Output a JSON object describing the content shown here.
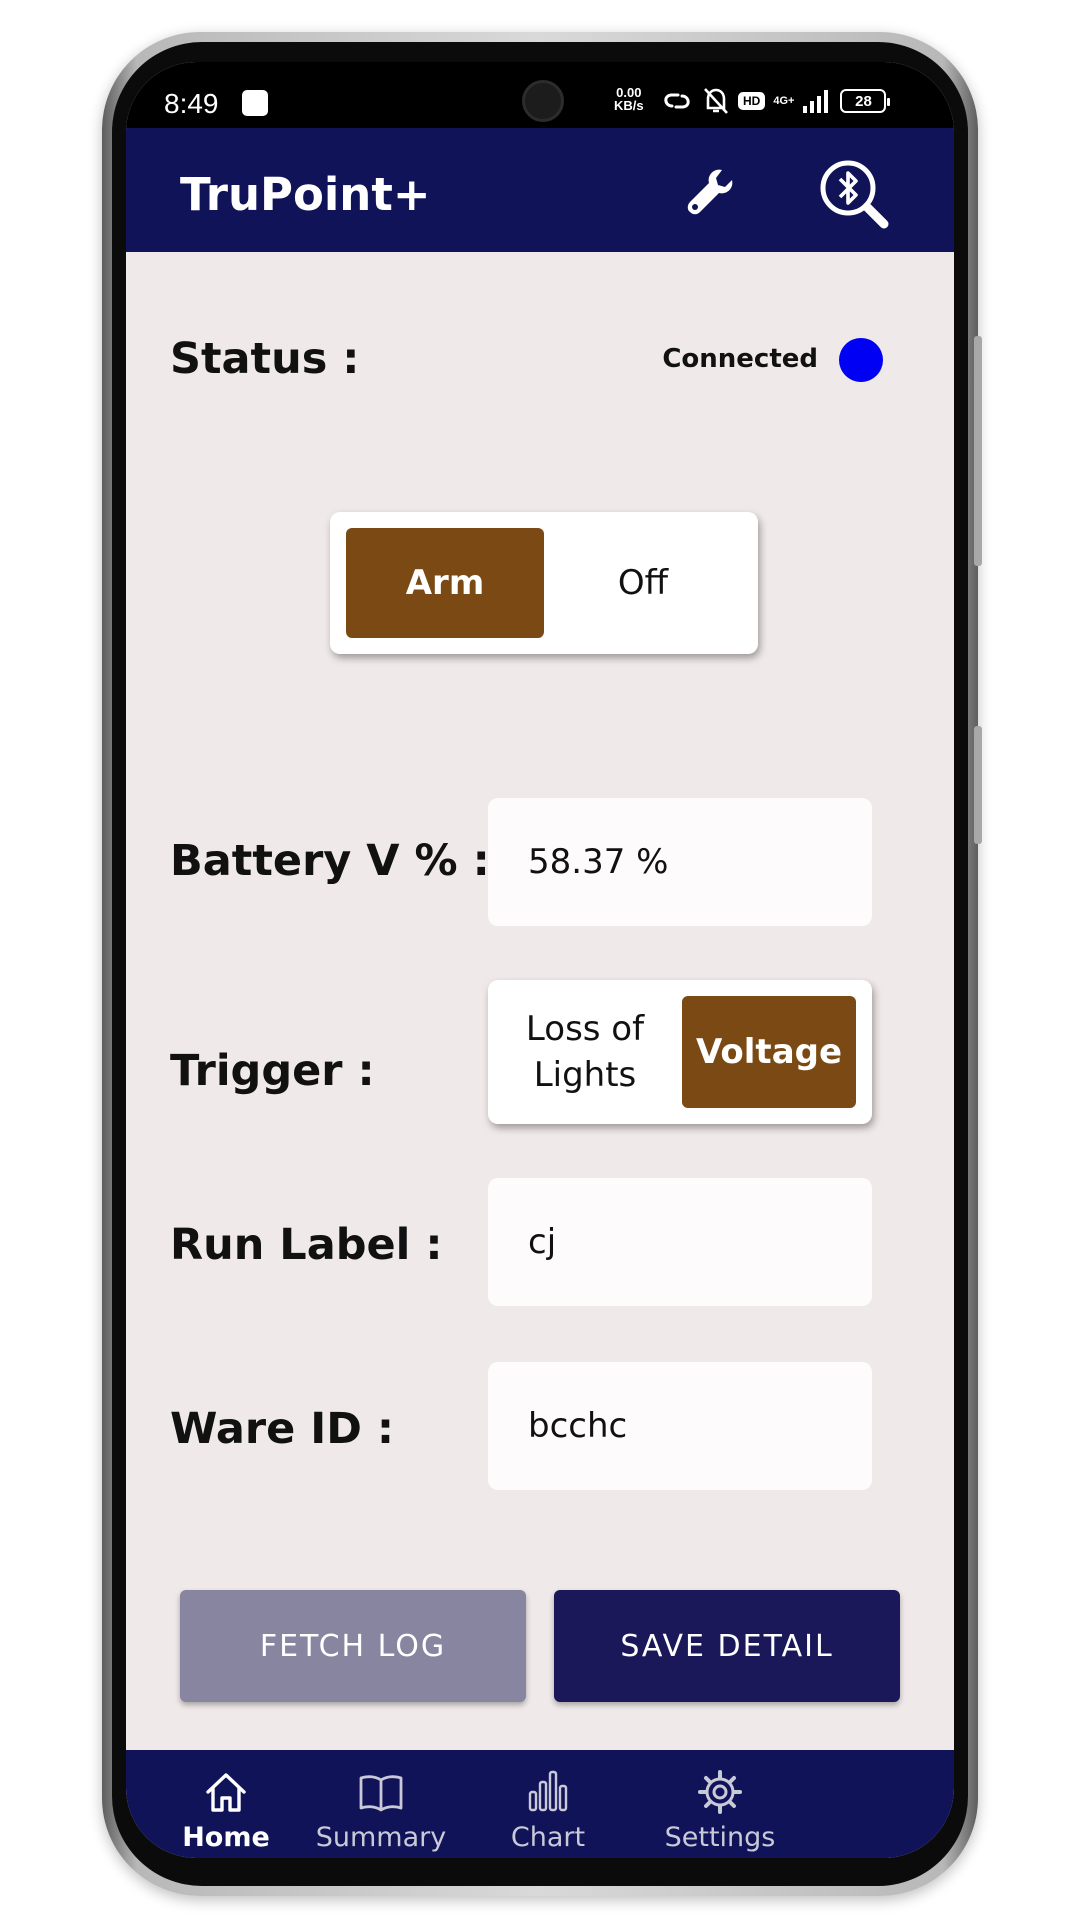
{
  "status_bar": {
    "time": "8:49",
    "net_speed_value": "0.00",
    "net_speed_unit": "KB/s",
    "hd_badge": "HD",
    "network_type": "4G+",
    "battery_level": "28"
  },
  "app_bar": {
    "title": "TruPoint+"
  },
  "status": {
    "label": "Status :",
    "value": "Connected",
    "indicator_color": "#0000f5"
  },
  "mode_toggle": {
    "options": [
      "Arm",
      "Off"
    ],
    "selected": "Arm"
  },
  "battery": {
    "label": "Battery V % :",
    "value": "58.37 %"
  },
  "trigger": {
    "label": "Trigger :",
    "options": [
      "Loss of Lights",
      "Voltage"
    ],
    "option_lines": [
      "Loss of",
      "Lights"
    ],
    "selected": "Voltage"
  },
  "run_label": {
    "label": "Run Label :",
    "value": "cj"
  },
  "ware_id": {
    "label": "Ware ID :",
    "value": "bcchc"
  },
  "buttons": {
    "fetch_log": "FETCH LOG",
    "save_detail": "SAVE DETAIL"
  },
  "bottom_nav": {
    "items": [
      {
        "label": "Home",
        "icon": "home-icon",
        "active": true
      },
      {
        "label": "Summary",
        "icon": "book-icon",
        "active": false
      },
      {
        "label": "Chart",
        "icon": "chart-icon",
        "active": false
      },
      {
        "label": "Settings",
        "icon": "gear-icon",
        "active": false
      }
    ]
  },
  "colors": {
    "primary": "#101358",
    "accent": "#7b4a14",
    "background": "#f0e9e9"
  }
}
